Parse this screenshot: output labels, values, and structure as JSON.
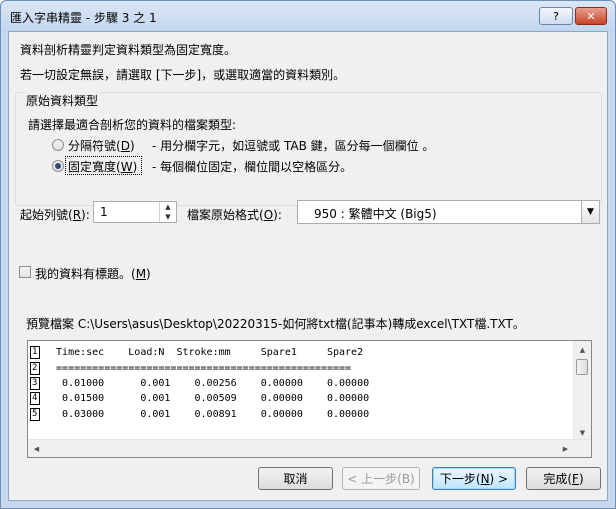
{
  "window": {
    "title": "匯入字串精靈 - 步驟 3 之 1",
    "help_label": "?",
    "close_label": "✕"
  },
  "intro": {
    "line1": "資料剖析精靈判定資料類型為固定寬度。",
    "line2": "若一切設定無誤，請選取 [下一步]，或選取適當的資料類別。"
  },
  "original_type": {
    "group_label": "原始資料類型",
    "prompt": "請選擇最適合剖析您的資料的檔案類型:",
    "options": [
      {
        "label": "分隔符號(",
        "key": "D",
        "label_end": ")",
        "desc": "- 用分欄字元，如逗號或 TAB 鍵，區分每一個欄位 。",
        "selected": false
      },
      {
        "label": "固定寬度(",
        "key": "W",
        "label_end": ")",
        "desc": "- 每個欄位固定，欄位間以空格區分。",
        "selected": true
      }
    ]
  },
  "start_row": {
    "label": "起始列號(",
    "key": "R",
    "label_end": "):",
    "value": "1"
  },
  "file_origin": {
    "label": "檔案原始格式(",
    "key": "O",
    "label_end": "):",
    "value": "950 : 繁體中文 (Big5)"
  },
  "headers_checkbox": {
    "label": "我的資料有標題。(",
    "key": "M",
    "label_end": ")",
    "checked": false
  },
  "preview": {
    "label": "預覽檔案 C:\\Users\\asus\\Desktop\\20220315-如何將txt檔(記事本)轉成excel\\TXT檔.TXT。",
    "rows": [
      {
        "num": "1",
        "text": "  Time:sec    Load:N  Stroke:mm     Spare1     Spare2"
      },
      {
        "num": "2",
        "text": "  ================================================="
      },
      {
        "num": "3",
        "text": "   0.01000      0.001    0.00256    0.00000    0.00000"
      },
      {
        "num": "4",
        "text": "   0.01500      0.001    0.00509    0.00000    0.00000"
      },
      {
        "num": "5",
        "text": "   0.03000      0.001    0.00891    0.00000    0.00000"
      }
    ]
  },
  "buttons": {
    "cancel": "取消",
    "back": "< 上一步(B)",
    "next_pre": "下一步(",
    "next_key": "N",
    "next_post": ") >",
    "finish_pre": "完成(",
    "finish_key": "F",
    "finish_post": ")"
  }
}
